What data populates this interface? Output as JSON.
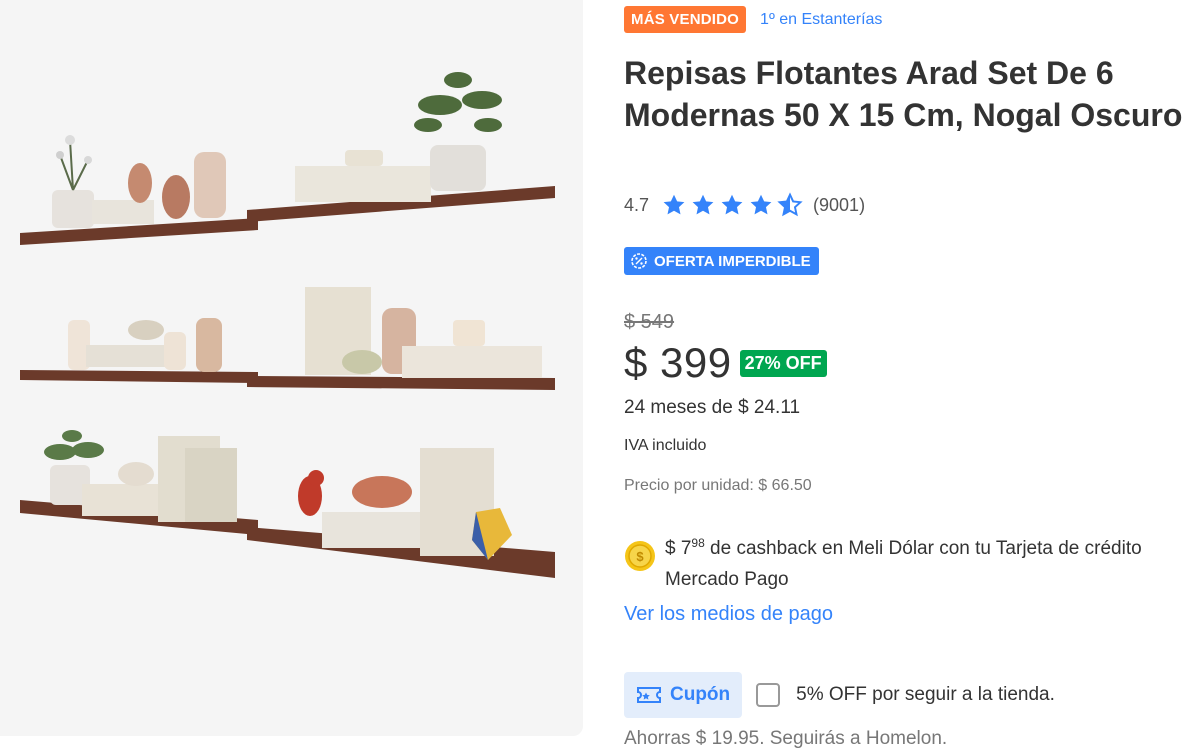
{
  "product": {
    "best_seller_badge": "MÁS VENDIDO",
    "rank_link": "1º en Estanterías",
    "title": "Repisas Flotantes Arad Set De 6 Modernas 50 X 15 Cm, Nogal Oscuro",
    "rating": {
      "value": "4.7",
      "stars_filled": 4.5,
      "reviews": "(9001)"
    },
    "deal_badge": "OFERTA IMPERDIBLE",
    "old_price": "$ 549",
    "price": "$ 399",
    "discount": "27% OFF",
    "installments": "24 meses de $ 24.11",
    "tax_note": "IVA incluido",
    "unit_price": "Precio por unidad: $ 66.50",
    "cashback": {
      "amount_main": "$ 7",
      "amount_cents": "98",
      "text": " de cashback en Meli Dólar con tu Tarjeta de crédito Mercado Pago"
    },
    "payment_link": "Ver los medios de pago",
    "coupon": {
      "label": "Cupón",
      "text": "5% OFF por seguir a la tienda.",
      "checked": false
    },
    "savings_note": "Ahorras $ 19.95. Seguirás a Homelon."
  },
  "colors": {
    "accent_blue": "#3483fa",
    "best_seller_orange": "#ff7733",
    "discount_green": "#00a650",
    "shelf_wood": "#6b3a2a"
  },
  "icons": {
    "star": "star-icon",
    "deal": "discount-gear-icon",
    "coin": "meli-dollar-coin-icon",
    "coupon": "ticket-icon"
  }
}
